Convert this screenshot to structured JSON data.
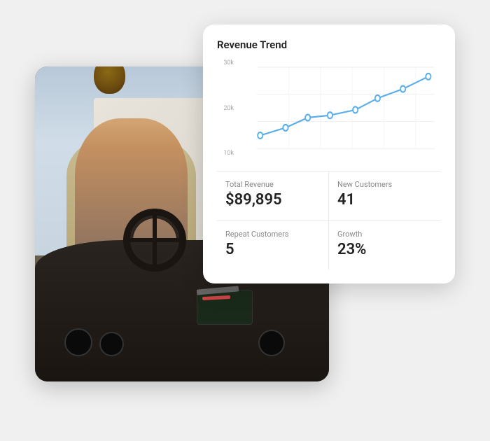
{
  "scene": {
    "photo_alt": "Truck driver smiling in cab"
  },
  "analytics": {
    "title": "Revenue Trend",
    "chart": {
      "y_labels": [
        "30k",
        "20k",
        "10k"
      ],
      "data_points": [
        {
          "x": 8,
          "y": 72,
          "label": "p1"
        },
        {
          "x": 18,
          "y": 68,
          "label": "p2"
        },
        {
          "x": 30,
          "y": 55,
          "label": "p3"
        },
        {
          "x": 44,
          "y": 38,
          "label": "p4"
        },
        {
          "x": 58,
          "y": 42,
          "label": "p5"
        },
        {
          "x": 70,
          "y": 25,
          "label": "p6"
        },
        {
          "x": 82,
          "y": 18,
          "label": "p7"
        },
        {
          "x": 94,
          "y": 8,
          "label": "p8"
        }
      ],
      "color": "#5baee8"
    },
    "stats": [
      {
        "label": "Total Revenue",
        "value": "$89,895",
        "key": "total_revenue"
      },
      {
        "label": "New Customers",
        "value": "41",
        "key": "new_customers"
      },
      {
        "label": "Repeat Customers",
        "value": "5",
        "key": "repeat_customers"
      },
      {
        "label": "Growth",
        "value": "23%",
        "key": "growth"
      }
    ]
  }
}
